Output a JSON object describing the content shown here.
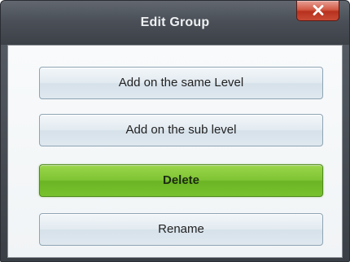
{
  "dialog": {
    "title": "Edit Group",
    "close_icon": "close-icon",
    "buttons": {
      "same_level": "Add on the same Level",
      "sub_level": "Add on the sub level",
      "delete": "Delete",
      "rename": "Rename"
    },
    "colors": {
      "titlebar": "#4b5058",
      "close_button": "#c84a36",
      "primary_button": "#7fc434",
      "default_button": "#e3ebf1"
    }
  }
}
